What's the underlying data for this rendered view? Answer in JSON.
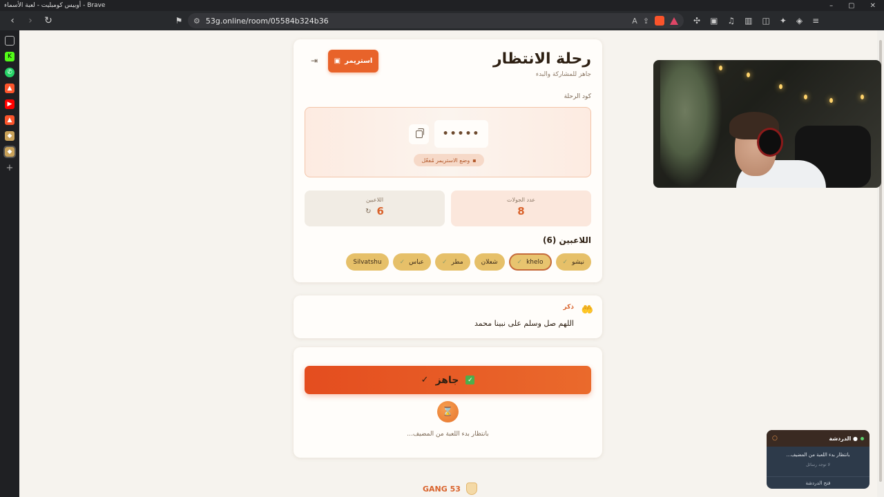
{
  "browser": {
    "window_title": "أوبيس كومبليت - لعبة الأسماء - Brave",
    "url": "53g.online/room/05584b324b36",
    "window_buttons": [
      "–",
      "▢",
      "✕"
    ]
  },
  "room": {
    "title": "رحلة الانتظار",
    "subtitle": "جاهز للمشاركة والبدء",
    "streamer_button": "استريمر",
    "code_label": "كود الرحلة",
    "code_value": "•••••",
    "streamer_mode_badge": "وضع الاستريمر مُفعّل",
    "rounds_label": "عدد الجولات",
    "rounds_value": "8",
    "players_label": "اللاعبين",
    "players_value": "6",
    "players_heading": "اللاعبين (6)",
    "players": [
      {
        "name": "نيشو",
        "checked": true,
        "active": false
      },
      {
        "name": "khelo",
        "checked": true,
        "active": true
      },
      {
        "name": "شعلان",
        "checked": false,
        "active": false
      },
      {
        "name": "مطر",
        "checked": true,
        "active": false
      },
      {
        "name": "عباس",
        "checked": true,
        "active": false
      },
      {
        "name": "Silvatshu",
        "checked": false,
        "active": false
      }
    ]
  },
  "dhikr": {
    "label": "ذكر",
    "text": "اللهم صل وسلم على نبينا محمد"
  },
  "ready": {
    "button_label": "جاهز",
    "waiting_text": "بانتظار بدء اللعبة من المضيف..."
  },
  "footer": {
    "logo_text": "GANG 53"
  },
  "chat": {
    "title": "الدردشة",
    "message": "بانتظار بدء اللعبة من المضيف...",
    "empty": "لا توجد رسائل",
    "open_label": "فتح الدردشة"
  },
  "colors": {
    "accent": "#e8632a",
    "chip": "#e6c069",
    "background": "#f6f3ee"
  }
}
